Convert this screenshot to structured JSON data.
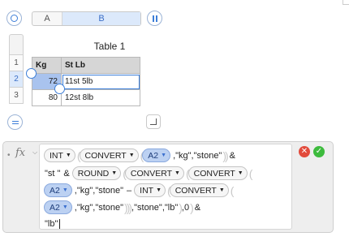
{
  "columns": {
    "a": "A",
    "b": "B"
  },
  "table": {
    "title": "Table 1",
    "headers": [
      "Kg",
      "St Lb"
    ],
    "row_numbers": [
      "1",
      "2",
      "3"
    ],
    "rows": [
      {
        "kg": "72",
        "stlb": "11st 5lb"
      },
      {
        "kg": "80",
        "stlb": "12st 8lb"
      }
    ]
  },
  "formula": {
    "fx_label": "fx",
    "tokens": {
      "int": "INT",
      "convert": "CONVERT",
      "round": "ROUND",
      "a2": "A2"
    },
    "strings": {
      "kg_stone": ",\"kg\",\"stone\"",
      "amp": "&",
      "st": "\"st \"",
      "minus": "–",
      "stone_lb": ",\"stone\",\"lb\"",
      "zero": ",0",
      "lb": "\"lb\""
    }
  },
  "buttons": {
    "cancel": "✕",
    "accept": "✓"
  },
  "colors": {
    "accent": "#3c7ed8",
    "ref_token": "#bcd1f2",
    "cancel": "#e24b3c",
    "accept": "#3dbb3d"
  }
}
